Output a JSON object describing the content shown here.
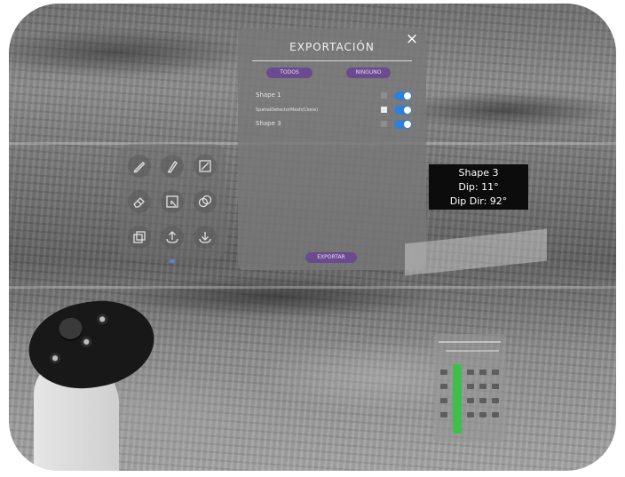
{
  "export_panel": {
    "title": "EXPORTACIÓN",
    "close_label": "×",
    "select_all_label": "TODOS",
    "select_none_label": "NINGUNO",
    "items": [
      {
        "label": "Shape 1",
        "checked": false,
        "toggle_on": true
      },
      {
        "label": "SpatialDetectorMesh(Clone)",
        "checked": true,
        "toggle_on": true
      },
      {
        "label": "Shape 3",
        "checked": false,
        "toggle_on": true
      }
    ],
    "export_button_label": "EXPORTAR"
  },
  "measurement_label": {
    "line1": "Shape 3",
    "line2": "Dip: 11°",
    "line3": "Dip Dir: 92°"
  },
  "tool_palette": {
    "tools": [
      "pencil-icon",
      "pen-icon",
      "line-draw-icon",
      "eraser-icon",
      "select-area-icon",
      "intersect-icon",
      "layers-icon",
      "upload-icon",
      "download-icon"
    ]
  },
  "colors": {
    "accent_purple": "#6b4a8f",
    "toggle_blue": "#2f80d8",
    "calc_green": "#3fbf4a",
    "label_background": "#0c0c0c"
  }
}
